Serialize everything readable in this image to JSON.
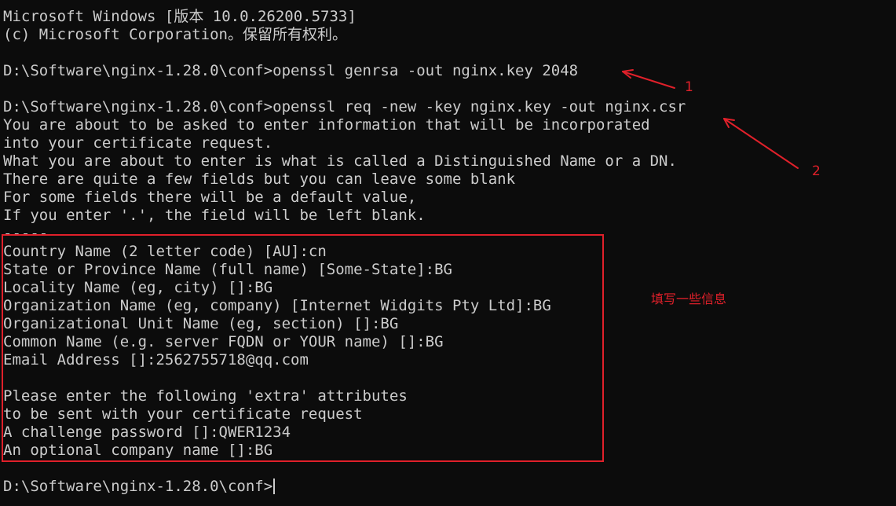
{
  "terminal": {
    "lines": [
      "Microsoft Windows [版本 10.0.26200.5733]",
      "(c) Microsoft Corporation。保留所有权利。",
      "",
      "D:\\Software\\nginx-1.28.0\\conf>openssl genrsa -out nginx.key 2048",
      "",
      "D:\\Software\\nginx-1.28.0\\conf>openssl req -new -key nginx.key -out nginx.csr",
      "You are about to be asked to enter information that will be incorporated",
      "into your certificate request.",
      "What you are about to enter is what is called a Distinguished Name or a DN.",
      "There are quite a few fields but you can leave some blank",
      "For some fields there will be a default value,",
      "If you enter '.', the field will be left blank.",
      "-----",
      "Country Name (2 letter code) [AU]:cn",
      "State or Province Name (full name) [Some-State]:BG",
      "Locality Name (eg, city) []:BG",
      "Organization Name (eg, company) [Internet Widgits Pty Ltd]:BG",
      "Organizational Unit Name (eg, section) []:BG",
      "Common Name (e.g. server FQDN or YOUR name) []:BG",
      "Email Address []:2562755718@qq.com",
      "",
      "Please enter the following 'extra' attributes",
      "to be sent with your certificate request",
      "A challenge password []:QWER1234",
      "An optional company name []:BG",
      "",
      "D:\\Software\\nginx-1.28.0\\conf>"
    ]
  },
  "annotations": {
    "arrow1_label": "1",
    "arrow2_label": "2",
    "note": "填写一些信息",
    "color": "#e0202a"
  },
  "colors": {
    "background": "#0c0c0c",
    "text": "#cccccc",
    "annotation": "#e0202a"
  }
}
